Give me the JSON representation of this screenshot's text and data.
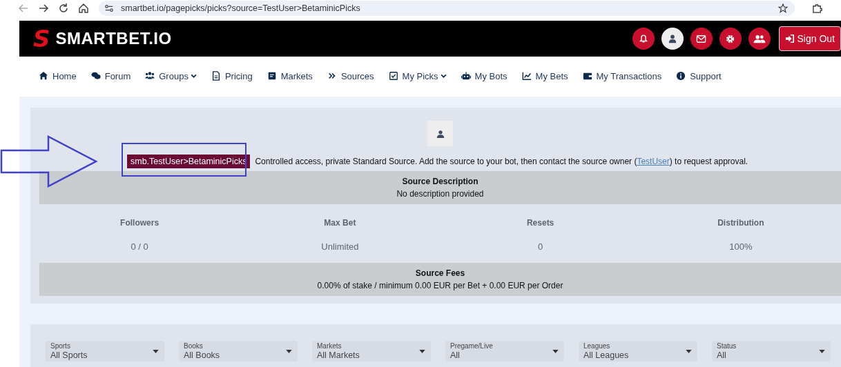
{
  "browser": {
    "url": "smartbet.io/pagepicks/picks?source=TestUser>BetaminicPicks"
  },
  "header": {
    "logo_mark": "S",
    "logo_text": "SMARTBET.IO",
    "sign_out": "Sign Out"
  },
  "nav": [
    {
      "label": "Home",
      "kind": "home",
      "dropdown": false
    },
    {
      "label": "Forum",
      "kind": "comments",
      "dropdown": false
    },
    {
      "label": "Groups",
      "kind": "users",
      "dropdown": true
    },
    {
      "label": "Pricing",
      "kind": "file",
      "dropdown": false
    },
    {
      "label": "Markets",
      "kind": "list",
      "dropdown": false
    },
    {
      "label": "Sources",
      "kind": "chevrons",
      "dropdown": false
    },
    {
      "label": "My Picks",
      "kind": "check",
      "dropdown": true
    },
    {
      "label": "My Bots",
      "kind": "robot",
      "dropdown": false
    },
    {
      "label": "My Bets",
      "kind": "chart",
      "dropdown": false
    },
    {
      "label": "My Transactions",
      "kind": "wallet",
      "dropdown": false
    },
    {
      "label": "Support",
      "kind": "info",
      "dropdown": false
    }
  ],
  "source": {
    "tag": "smb.TestUser>BetaminicPicks",
    "notice_before": "Controlled access, private Standard Source. Add the source to your bot, then contact the source owner (",
    "owner_link": "TestUser",
    "notice_after": ") to request approval.",
    "description_title": "Source Description",
    "description": "No description provided",
    "stats": [
      {
        "label": "Followers",
        "value": "0 / 0"
      },
      {
        "label": "Max Bet",
        "value": "Unlimited"
      },
      {
        "label": "Resets",
        "value": "0"
      },
      {
        "label": "Distribution",
        "value": "100%"
      }
    ],
    "fees_title": "Source Fees",
    "fees": "0.00% of stake / minimum 0.00 EUR per Bet + 0.00 EUR per Order"
  },
  "filters": [
    {
      "label": "Sports",
      "value": "All Sports"
    },
    {
      "label": "Books",
      "value": "All Books"
    },
    {
      "label": "Markets",
      "value": "All Markets"
    },
    {
      "label": "Pregame/Live",
      "value": "All"
    },
    {
      "label": "Leagues",
      "value": "All Leagues"
    },
    {
      "label": "Status",
      "value": "All"
    }
  ]
}
